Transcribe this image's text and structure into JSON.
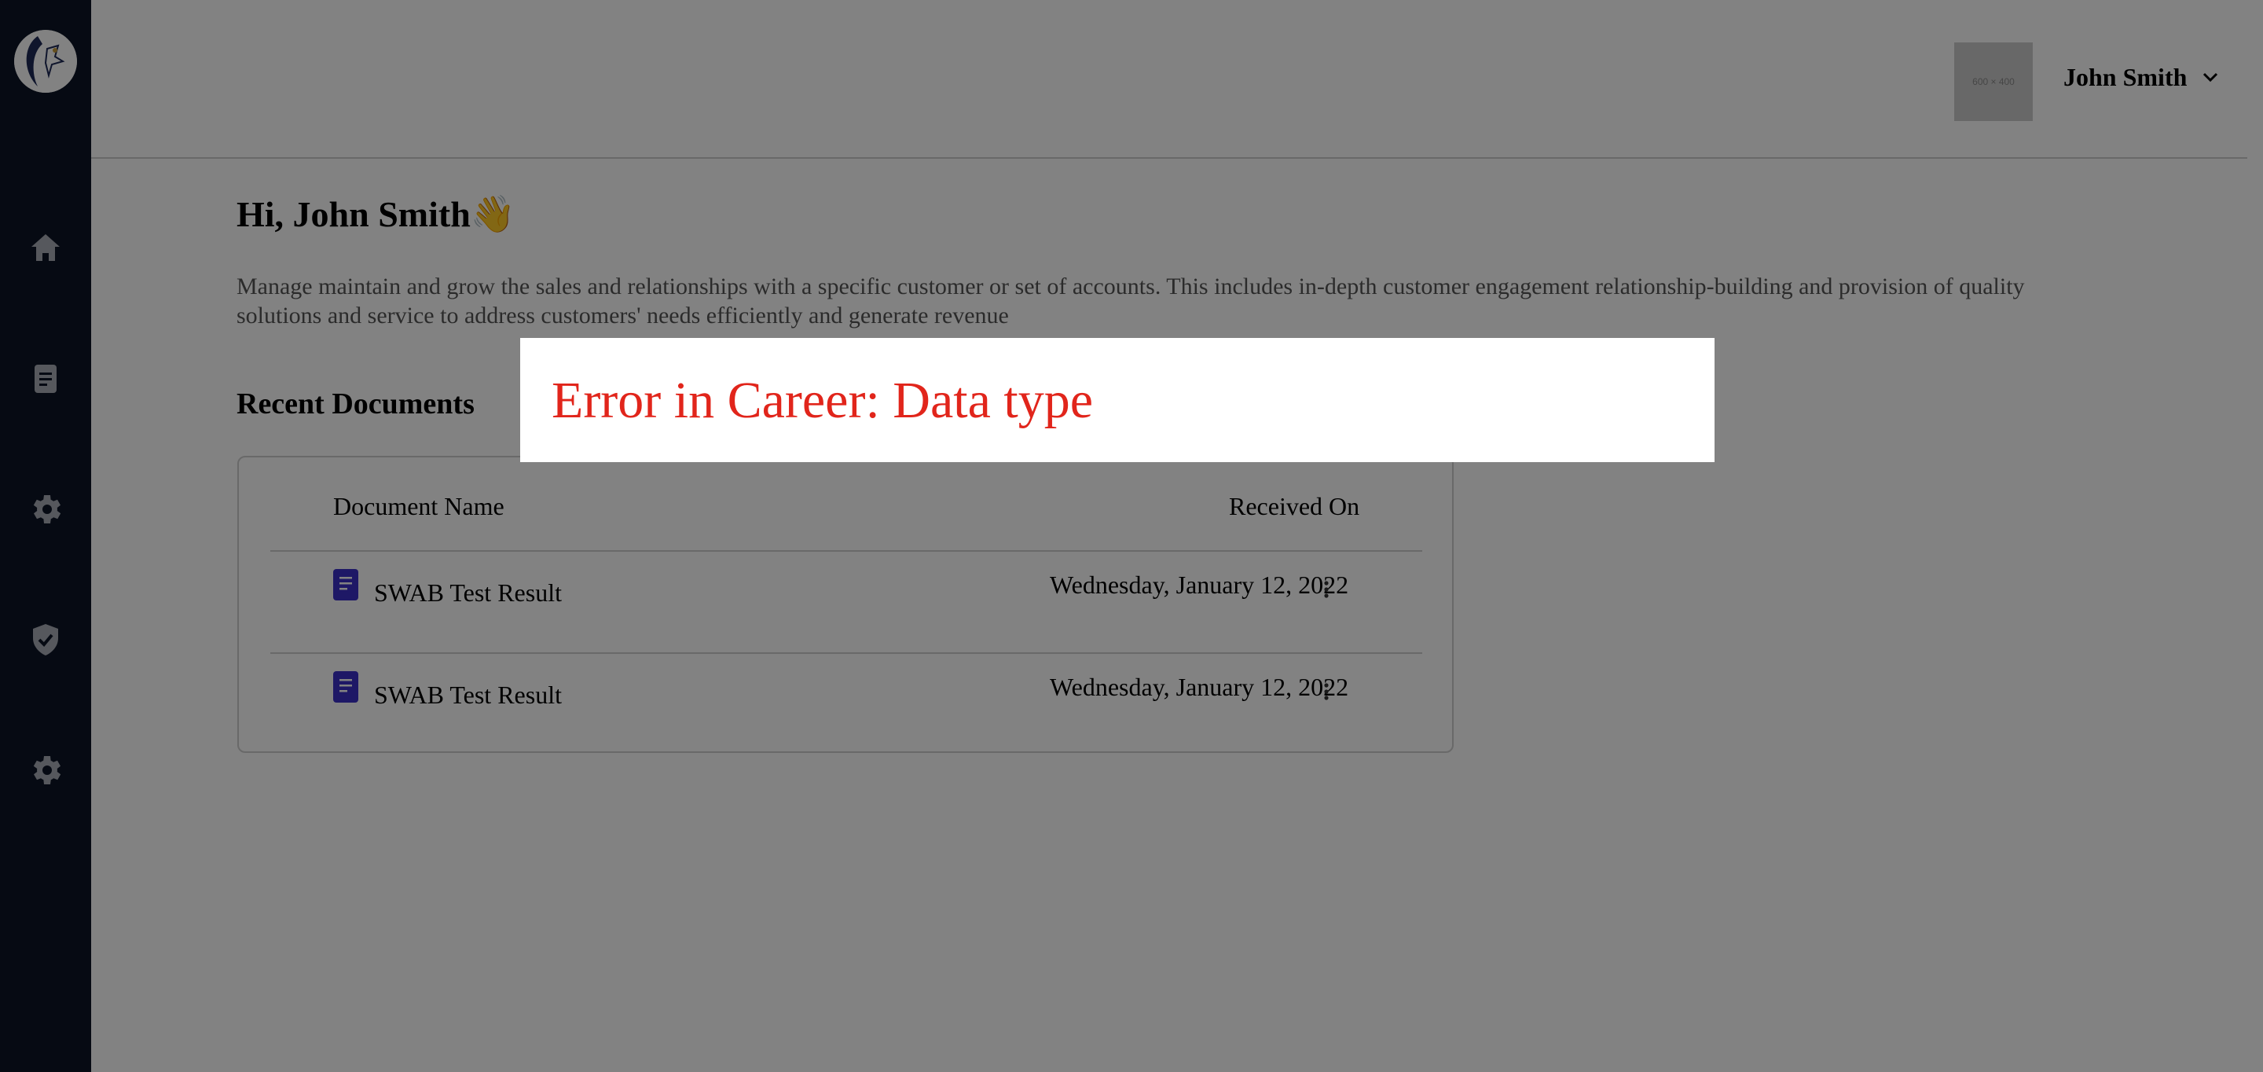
{
  "header": {
    "avatar_placeholder": "600 × 400",
    "user_name": "John Smith"
  },
  "main": {
    "greeting": "Hi, John Smith👋",
    "description": "Manage maintain and grow the sales and relationships with a specific customer or set of accounts. This includes in-depth customer engagement relationship-building and provision of quality solutions and service to address customers' needs efficiently and generate revenue",
    "recent_documents_title": "Recent Documents",
    "table": {
      "columns": [
        "Document Name",
        "Received On"
      ],
      "rows": [
        {
          "name": "SWAB Test Result",
          "received_on": "Wednesday, January 12, 2022"
        },
        {
          "name": "SWAB Test Result",
          "received_on": "Wednesday, January 12, 2022"
        }
      ]
    }
  },
  "sidebar": {
    "items": [
      {
        "icon": "home-icon"
      },
      {
        "icon": "document-icon"
      },
      {
        "icon": "gear-icon"
      },
      {
        "icon": "shield-check-icon"
      },
      {
        "icon": "gear-icon"
      }
    ]
  },
  "error_modal": {
    "message": "Error in Career: Data type"
  },
  "colors": {
    "sidebar_bg": "#0c1526",
    "doc_icon": "#3b2fc9",
    "error_text": "#e1251b"
  }
}
